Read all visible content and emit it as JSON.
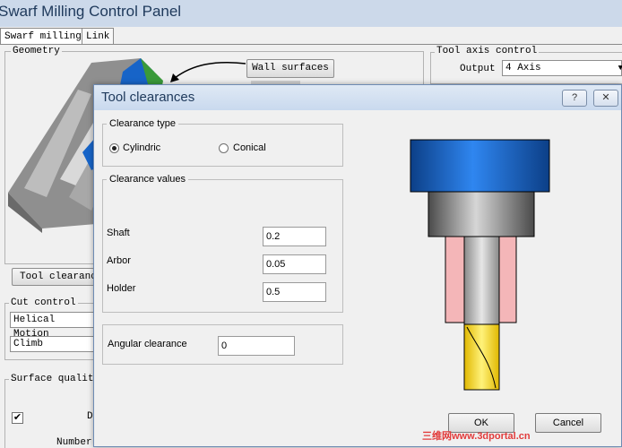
{
  "main_window": {
    "title": "Swarf Milling Control Panel",
    "tabs": [
      "Swarf milling",
      "Link"
    ],
    "geometry": {
      "label": "Geometry",
      "wall_surfaces_button": "Wall surfaces"
    },
    "tool_axis_control": {
      "label": "Tool axis control",
      "output_label": "Output",
      "output_value": "4 Axis"
    },
    "tool_clearance_button": "Tool clearance",
    "cut_control": {
      "label": "Cut control",
      "helical_motion": "Helical Motion",
      "direction": "Climb"
    },
    "surface_quality": {
      "label": "Surface quality",
      "checkbox_checked": true,
      "row_text": "D",
      "number_label": "Number"
    }
  },
  "dialog": {
    "title": "Tool clearances",
    "help_button": "?",
    "close_button": "✕",
    "clearance_type": {
      "label": "Clearance type",
      "options": [
        {
          "label": "Cylindric",
          "selected": true
        },
        {
          "label": "Conical",
          "selected": false
        }
      ]
    },
    "clearance_values": {
      "label": "Clearance values",
      "fields": [
        {
          "label": "Shaft",
          "value": "0.2"
        },
        {
          "label": "Arbor",
          "value": "0.05"
        },
        {
          "label": "Holder",
          "value": "0.5"
        }
      ]
    },
    "angular_clearance": {
      "label": "Angular clearance",
      "value": "0"
    },
    "ok_button": "OK",
    "cancel_button": "Cancel"
  },
  "watermark": "三维网www.3dportal.cn",
  "colors": {
    "dialog_border": "#6e8bb3",
    "holder_blue": "#1e6fd1",
    "arbor_gray": "#8a8a8a",
    "clearance_pink": "#f4b6b8",
    "cutter_yellow": "#f5d800",
    "part_green": "#3a9a3a"
  }
}
